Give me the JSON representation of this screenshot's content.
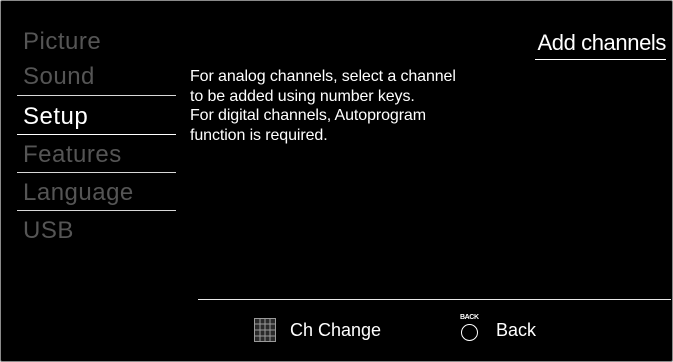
{
  "menu": {
    "items": [
      {
        "label": "Picture"
      },
      {
        "label": "Sound"
      },
      {
        "label": "Setup"
      },
      {
        "label": "Features"
      },
      {
        "label": "Language"
      },
      {
        "label": "USB"
      }
    ],
    "selected_index": 2
  },
  "panel": {
    "title": "Add channels",
    "description_lines": [
      "For analog channels, select a channel",
      "to be added using number keys.",
      "For digital channels, Autoprogram",
      "function is required."
    ]
  },
  "footer": {
    "ch_change": {
      "icon": "number-keypad-icon",
      "label": "Ch Change"
    },
    "back": {
      "icon": "back-button-icon",
      "icon_text": "BACK",
      "label": "Back"
    }
  },
  "colors": {
    "background": "#000000",
    "text": "#ffffff",
    "inactive_text": "#555555",
    "border": "#8a8a8a"
  }
}
